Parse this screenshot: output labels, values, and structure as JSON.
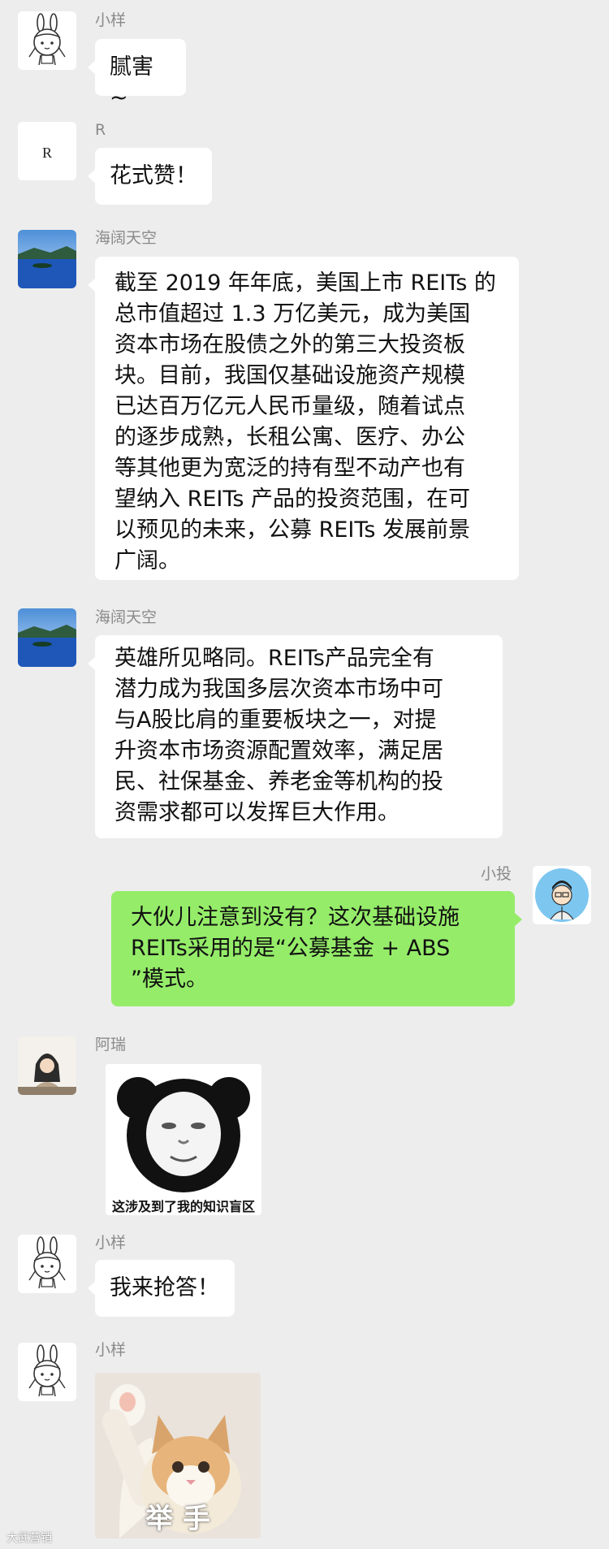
{
  "messages": [
    {
      "sender": "小样",
      "text": "腻害~"
    },
    {
      "sender": "R",
      "avatar_letter": "R",
      "text": "花式赞！"
    },
    {
      "sender": "海阔天空",
      "text": "截至 2019 年年底，美国上市 REITs 的\n总市值超过 1.3 万亿美元，成为美国\n资本市场在股债之外的第三大投资板\n块。目前，我国仅基础设施资产规模\n已达百万亿元人民币量级，随着试点\n的逐步成熟，长租公寓、医疗、办公\n等其他更为宽泛的持有型不动产也有\n望纳入 REITs 产品的投资范围，在可\n以预见的未来，公募 REITs 发展前景\n广阔。"
    },
    {
      "sender": "海阔天空",
      "text": "英雄所见略同。REITs产品完全有\n潜力成为我国多层次资本市场中可\n与A股比肩的重要板块之一，对提\n升资本市场资源配置效率，满足居\n民、社保基金、养老金等机构的投\n资需求都可以发挥巨大作用。"
    },
    {
      "sender": "小投",
      "text": "大伙儿注意到没有？这次基础设施\nREITs采用的是“公募基金 + ABS\n”模式。"
    },
    {
      "sender": "阿瑞",
      "sticker_caption": "这涉及到了我的知识盲区"
    },
    {
      "sender": "小样",
      "text": "我来抢答！"
    },
    {
      "sender": "小样",
      "sticker_caption": "举 手"
    }
  ],
  "watermark": "大武营销",
  "colors": {
    "background": "#ededed",
    "bubble_left": "#ffffff",
    "bubble_right": "#95ec69",
    "name": "#8a8a8a"
  },
  "icons": {
    "bunny": "bunny-avatar-icon",
    "letter": "r-avatar-icon",
    "lake": "lake-avatar-icon",
    "boy": "cartoon-boy-avatar-icon",
    "girl": "girl-avatar-icon"
  }
}
